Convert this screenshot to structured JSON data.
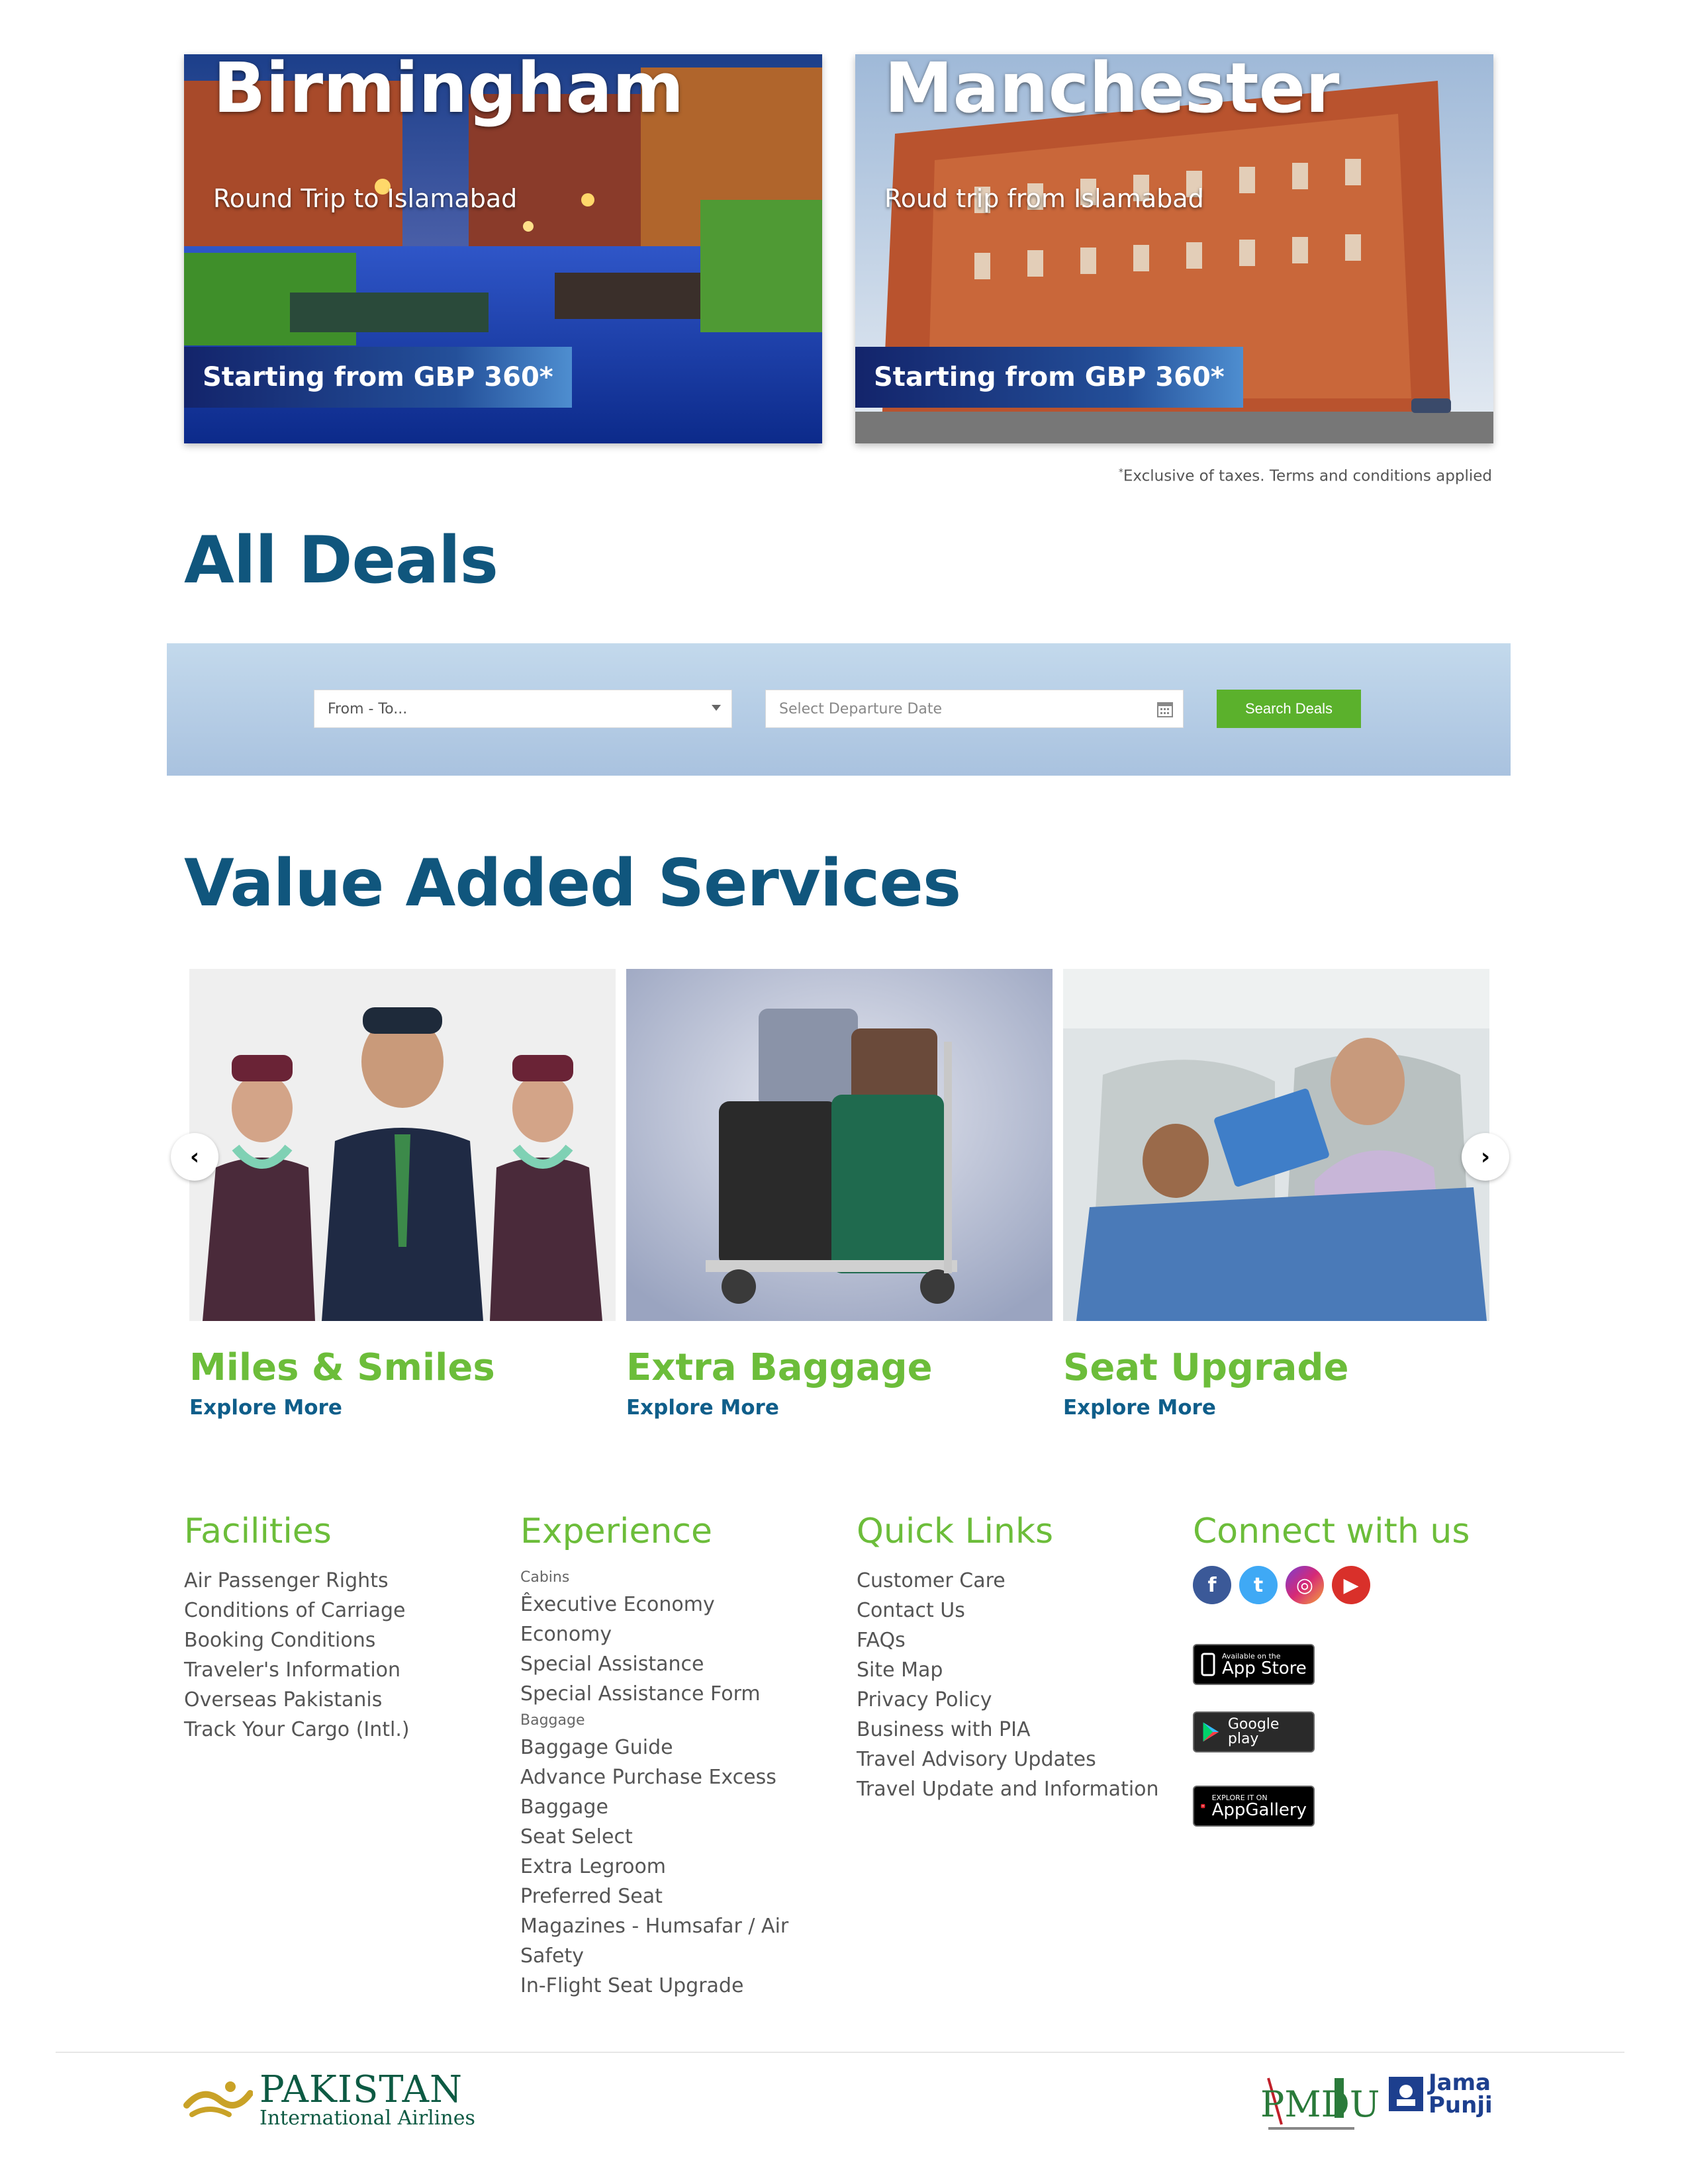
{
  "deals": [
    {
      "city": "Birmingham",
      "subtitle": "Round Trip to Islamabad",
      "price": "Starting from GBP 360*"
    },
    {
      "city": "Manchester",
      "subtitle": "Roud trip from Islamabad",
      "price": "Starting from GBP 360*"
    }
  ],
  "disclaimer": "Exclusive of taxes. Terms and conditions applied",
  "all_deals": {
    "heading": "All Deals",
    "route_placeholder": "From - To...",
    "date_placeholder": "Select Departure Date",
    "search_label": "Search Deals"
  },
  "services": {
    "heading": "Value Added Services",
    "items": [
      {
        "title": "Miles & Smiles",
        "link": "Explore More"
      },
      {
        "title": "Extra Baggage",
        "link": "Explore More"
      },
      {
        "title": "Seat Upgrade",
        "link": "Explore More"
      }
    ],
    "prev_arrow": "‹",
    "next_arrow": "›"
  },
  "footer": {
    "facilities": {
      "heading": "Facilities",
      "links": [
        "Air Passenger Rights",
        "Conditions of Carriage",
        "Booking Conditions",
        "Traveler's Information",
        "Overseas Pakistanis",
        "Track Your Cargo (Intl.)"
      ]
    },
    "experience": {
      "heading": "Experience",
      "cabins_label": "Cabins",
      "cabins": [
        "Êxecutive Economy",
        "Economy",
        "Special Assistance",
        "Special Assistance Form"
      ],
      "baggage_label": "Baggage",
      "baggage": [
        "Baggage Guide",
        "Advance Purchase Excess",
        "Baggage",
        "Seat Select",
        "Extra Legroom",
        "Preferred Seat",
        "Magazines - Humsafar / Air",
        "Safety",
        "In-Flight Seat Upgrade"
      ]
    },
    "quick_links": {
      "heading": "Quick Links",
      "links": [
        "Customer Care",
        "Contact Us",
        "FAQs",
        "Site Map",
        "Privacy Policy",
        "Business with PIA",
        "Travel Advisory Updates",
        "Travel Update and Information"
      ]
    },
    "connect": {
      "heading": "Connect with us",
      "social": [
        {
          "icon": "facebook-icon",
          "glyph": "f",
          "color": "#3b5998"
        },
        {
          "icon": "twitter-icon",
          "glyph": "t",
          "color": "#3fa9f5"
        },
        {
          "icon": "instagram-icon",
          "glyph": "◎",
          "color": "#d62976"
        },
        {
          "icon": "youtube-icon",
          "glyph": "▶",
          "color": "#d9302a"
        }
      ],
      "app_store": {
        "small": "Available on the",
        "big": "App Store"
      },
      "google_play": {
        "big": "Google play"
      },
      "app_gallery": {
        "small": "EXPLORE IT ON",
        "big": "AppGallery"
      }
    }
  },
  "branding": {
    "pia_name": "PAKISTAN",
    "pia_sub": "International Airlines",
    "pmdu": "PMDU",
    "jama_line1": "Jama",
    "jama_line2": "Punji"
  }
}
